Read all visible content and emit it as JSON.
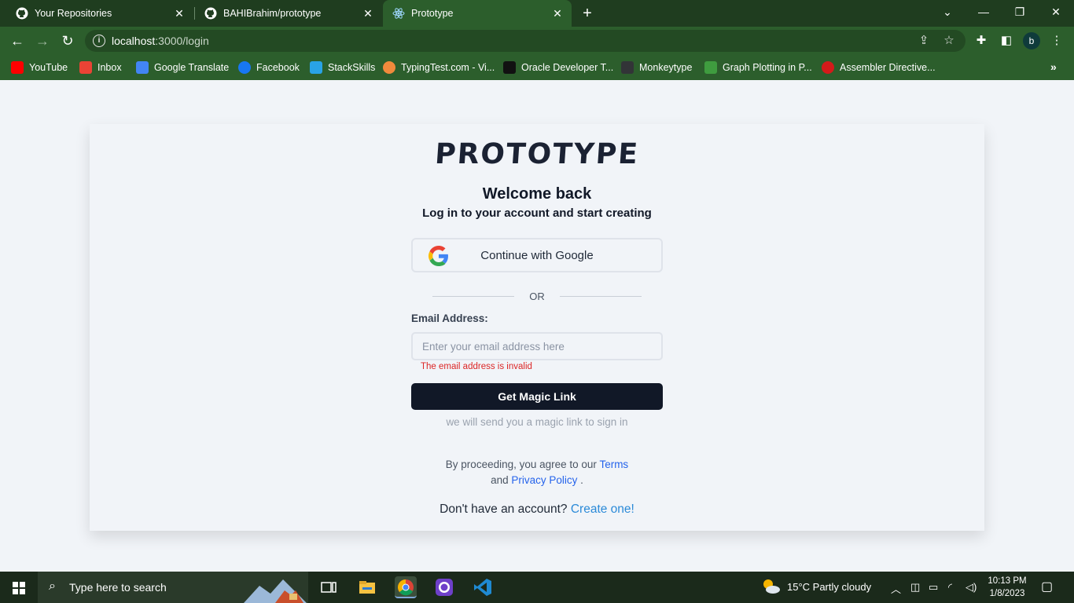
{
  "browser": {
    "tabs": [
      {
        "title": "Your Repositories",
        "active": false
      },
      {
        "title": "BAHIBrahim/prototype",
        "active": false
      },
      {
        "title": "Prototype",
        "active": true
      }
    ],
    "url_host": "localhost",
    "url_path": ":3000/login",
    "profile_initial": "b",
    "bookmarks": [
      {
        "label": "YouTube",
        "color": "#ff0000"
      },
      {
        "label": "Inbox",
        "color": "#ea4335"
      },
      {
        "label": "Google Translate",
        "color": "#4285f4"
      },
      {
        "label": "Facebook",
        "color": "#1877f2"
      },
      {
        "label": "StackSkills",
        "color": "#29a3e6"
      },
      {
        "label": "TypingTest.com - Vi...",
        "color": "#f08a3c"
      },
      {
        "label": "Oracle Developer T...",
        "color": "#111111"
      },
      {
        "label": "Monkeytype",
        "color": "#323437"
      },
      {
        "label": "Graph Plotting in P...",
        "color": "#3f9c3f"
      },
      {
        "label": "Assembler Directive...",
        "color": "#d41a1a"
      }
    ]
  },
  "login": {
    "logo": "PROTOTYPE",
    "heading": "Welcome back",
    "subheading": "Log in to your account and start creating",
    "google_button": "Continue with Google",
    "divider": "OR",
    "email_label": "Email Address:",
    "email_placeholder": "Enter your email address here",
    "email_value": "",
    "error": "The email address is invalid",
    "submit": "Get Magic Link",
    "note": "we will send you a magic link to sign in",
    "terms_prefix": "By proceeding, you agree to our",
    "terms_link": "Terms",
    "terms_and": "and",
    "privacy_link": "Privacy Policy",
    "terms_suffix": ".",
    "signup_prefix": "Don't have an account?",
    "signup_link": "Create one!"
  },
  "taskbar": {
    "search_placeholder": "Type here to search",
    "weather": "15°C  Partly cloudy",
    "time": "10:13 PM",
    "date": "1/8/2023"
  },
  "colors": {
    "browser_frame": "#2c5e2c",
    "primary_button": "#111827",
    "link": "#2563eb",
    "error": "#dc2626"
  }
}
